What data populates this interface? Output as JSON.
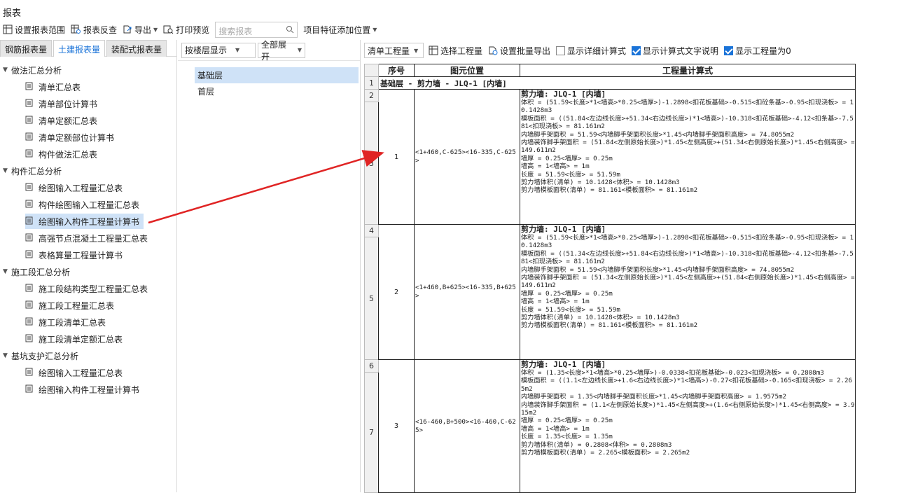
{
  "window": {
    "title": "报表"
  },
  "toolbar": {
    "set_range": "设置报表范围",
    "reverse_check": "报表反查",
    "export": "导出",
    "print_preview": "打印预览",
    "search_placeholder": "搜索报表",
    "feature_position": "项目特征添加位置"
  },
  "left_tabs": [
    "钢筋报表量",
    "土建报表量",
    "装配式报表量"
  ],
  "tree": [
    {
      "label": "做法汇总分析",
      "type": "group"
    },
    {
      "label": "清单汇总表",
      "type": "item"
    },
    {
      "label": "清单部位计算书",
      "type": "item"
    },
    {
      "label": "清单定额汇总表",
      "type": "item"
    },
    {
      "label": "清单定额部位计算书",
      "type": "item"
    },
    {
      "label": "构件做法汇总表",
      "type": "item"
    },
    {
      "label": "构件汇总分析",
      "type": "group"
    },
    {
      "label": "绘图输入工程量汇总表",
      "type": "item"
    },
    {
      "label": "构件绘图输入工程量汇总表",
      "type": "item"
    },
    {
      "label": "绘图输入构件工程量计算书",
      "type": "item",
      "selected": true
    },
    {
      "label": "高强节点混凝土工程量汇总表",
      "type": "item"
    },
    {
      "label": "表格算量工程量计算书",
      "type": "item"
    },
    {
      "label": "施工段汇总分析",
      "type": "group"
    },
    {
      "label": "施工段结构类型工程量汇总表",
      "type": "item"
    },
    {
      "label": "施工段工程量汇总表",
      "type": "item"
    },
    {
      "label": "施工段清单汇总表",
      "type": "item"
    },
    {
      "label": "施工段清单定额汇总表",
      "type": "item"
    },
    {
      "label": "基坑支护汇总分析",
      "type": "group"
    },
    {
      "label": "绘图输入工程量汇总表",
      "type": "item"
    },
    {
      "label": "绘图输入构件工程量计算书",
      "type": "item"
    }
  ],
  "middle": {
    "floor_mode": "按楼层显示",
    "expand_mode": "全部展开",
    "floors": [
      "基础层",
      "首层"
    ]
  },
  "right_toolbar": {
    "qty_type": "清单工程量",
    "select_qty": "选择工程量",
    "batch_export": "设置批量导出",
    "checkboxes": [
      {
        "label": "显示详细计算式",
        "checked": false
      },
      {
        "label": "显示计算式文字说明",
        "checked": true
      },
      {
        "label": "显示工程量为0",
        "checked": true
      }
    ]
  },
  "report": {
    "headers": [
      "序号",
      "图元位置",
      "工程量计算式"
    ],
    "section": "基础层 - 剪力墙 - JLQ-1 [内墙]",
    "rows": [
      {
        "seq": "1",
        "position": "<1+460,C-625><16-335,C-625>",
        "title": "剪力墙: JLQ-1 [内墙]",
        "lines": [
          "体积 = (51.59<长度>*1<墙高>*0.25<墙厚>)-1.2898<扣花板基础>-0.515<扣砼条基>-0.95<扣现浇板> = 10.1428m3",
          "模板面积 = ((51.84<左边线长度>+51.34<右边线长度>)*1<墙高>)-10.318<扣花板基础>-4.12<扣条基>-7.581<扣现浇板> = 81.161m2",
          "内墙脚手架面积 = 51.59<内墙脚手架面积长度>*1.45<内墙脚手架面积高度> = 74.8055m2",
          "内墙装饰脚手架面积 = (51.84<左侧原始长度>)*1.45<左侧高度>+(51.34<右侧原始长度>)*1.45<右侧高度> = 149.611m2",
          "墙厚 = 0.25<墙厚> = 0.25m",
          "墙高 = 1<墙高> = 1m",
          "长度 = 51.59<长度> = 51.59m",
          "剪力墙体积(清单) = 10.1428<体积> = 10.1428m3",
          "剪力墙模板面积(清单) = 81.161<模板面积> = 81.161m2"
        ]
      },
      {
        "seq": "2",
        "position": "<1+460,B+625><16-335,B+625>",
        "title": "剪力墙: JLQ-1 [内墙]",
        "lines": [
          "体积 = (51.59<长度>*1<墙高>*0.25<墙厚>)-1.2898<扣花板基础>-0.515<扣砼条基>-0.95<扣现浇板> = 10.1428m3",
          "模板面积 = ((51.34<左边线长度>+51.84<右边线长度>)*1<墙高>)-10.318<扣花板基础>-4.12<扣条基>-7.581<扣现浇板> = 81.161m2",
          "内墙脚手架面积 = 51.59<内墙脚手架面积长度>*1.45<内墙脚手架面积高度> = 74.8055m2",
          "内墙装饰脚手架面积 = (51.34<左侧原始长度>)*1.45<左侧高度>+(51.84<右侧原始长度>)*1.45<右侧高度> = 149.611m2",
          "墙厚 = 0.25<墙厚> = 0.25m",
          "墙高 = 1<墙高> = 1m",
          "长度 = 51.59<长度> = 51.59m",
          "剪力墙体积(清单) = 10.1428<体积> = 10.1428m3",
          "剪力墙模板面积(清单) = 81.161<模板面积> = 81.161m2"
        ]
      },
      {
        "seq": "3",
        "position": "<16-460,B+500><16-460,C-625>",
        "title": "剪力墙: JLQ-1 [内墙]",
        "lines": [
          "体积 = (1.35<长度>*1<墙高>*0.25<墙厚>)-0.0338<扣花板基础>-0.023<扣现浇板> = 0.2808m3",
          "模板面积 = ((1.1<左边线长度>+1.6<右边线长度>)*1<墙高>)-0.27<扣花板基础>-0.165<扣现浇板> = 2.265m2",
          "内墙脚手架面积 = 1.35<内墙脚手架面积长度>*1.45<内墙脚手架面积高度> = 1.9575m2",
          "内墙装饰脚手架面积 = (1.1<左侧原始长度>)*1.45<左侧高度>+(1.6<右侧原始长度>)*1.45<右侧高度> = 3.915m2",
          "墙厚 = 0.25<墙厚> = 0.25m",
          "墙高 = 1<墙高> = 1m",
          "长度 = 1.35<长度> = 1.35m",
          "剪力墙体积(清单) = 0.2808<体积> = 0.2808m3",
          "剪力墙模板面积(清单) = 2.265<模板面积> = 2.265m2"
        ]
      }
    ],
    "row_numbers": [
      "1",
      "2",
      "3",
      "4",
      "5",
      "6",
      "7"
    ]
  },
  "colors": {
    "accent": "#1a73d8",
    "selected_bg": "#cfe2f7",
    "annotation_arrow": "#e02424"
  }
}
